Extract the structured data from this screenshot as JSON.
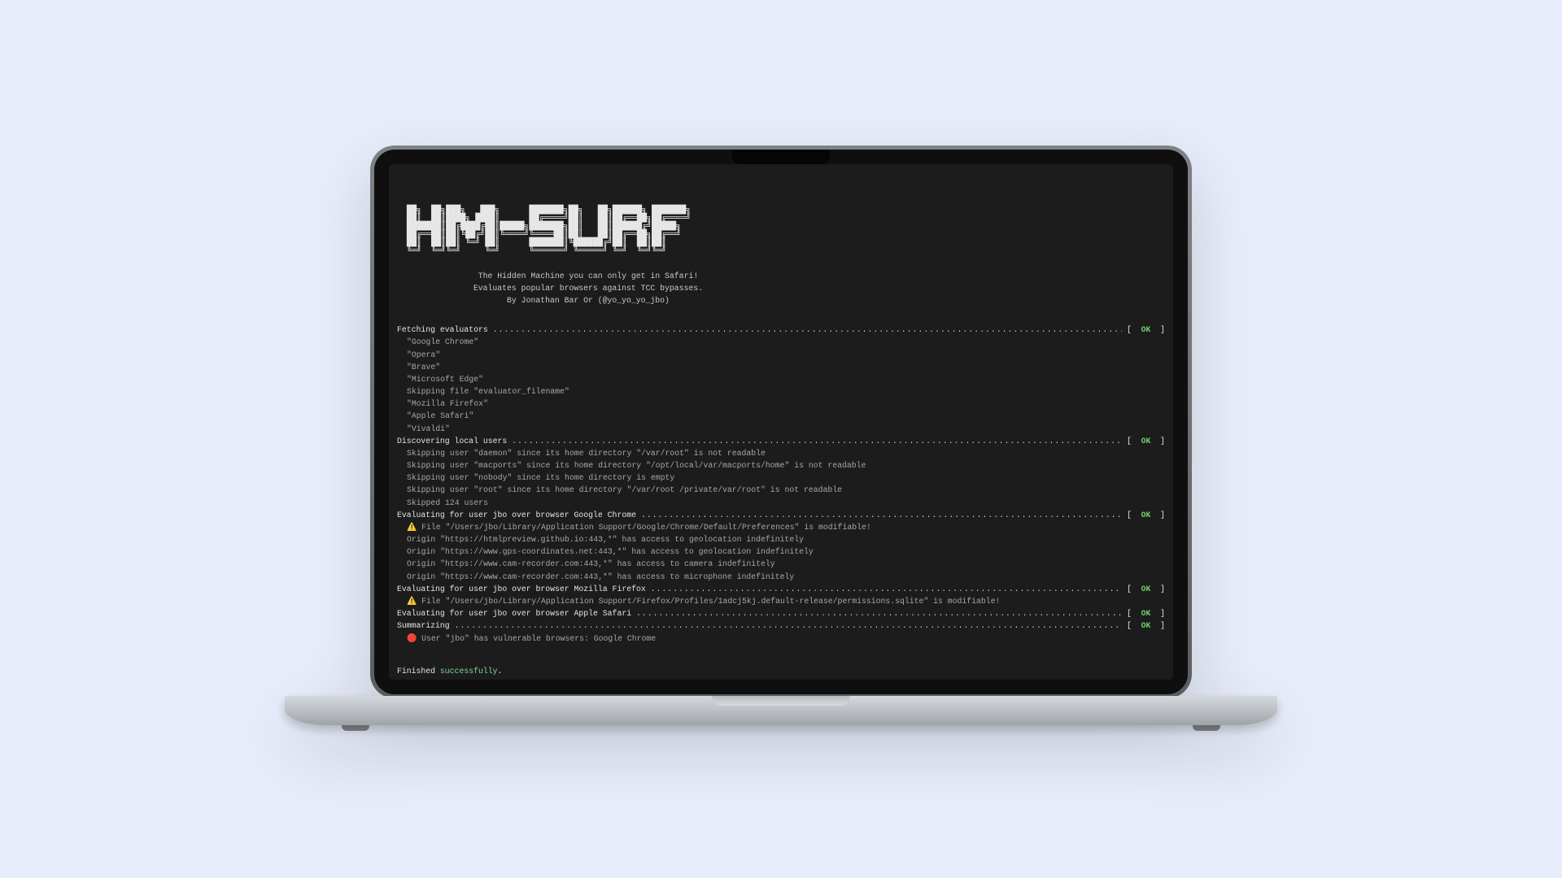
{
  "logo_ascii": "  ██╗  ██╗███╗   ███╗      ███████╗██╗   ██╗██████╗ ███████╗\n  ██║  ██║████╗ ████║      ██╔════╝██║   ██║██╔══██╗██╔════╝\n  ███████║██╔████╔██║█████╗███████╗██║   ██║██████╔╝█████╗  \n  ██╔══██║██║╚██╔╝██║╚════╝╚════██║██║   ██║██╔══██╗██╔══╝  \n  ██║  ██║██║ ╚═╝ ██║      ███████║╚██████╔╝██║  ██║██║     \n  ╚═╝  ╚═╝╚═╝     ╚═╝      ╚══════╝ ╚═════╝ ╚═╝  ╚═╝╚═╝     ",
  "subtitle_line1": "The Hidden Machine you can only get in Safari!",
  "subtitle_line2": "Evaluates popular browsers against TCC bypasses.",
  "subtitle_line3": "By Jonathan Bar Or (@yo_yo_yo_jbo)",
  "status_ok": "OK",
  "bracket_open": "[  ",
  "bracket_close": "  ]",
  "sections": [
    {
      "title": "Fetching evaluators ",
      "children": [
        "\"Google Chrome\"",
        "\"Opera\"",
        "\"Brave\"",
        "\"Microsoft Edge\"",
        "Skipping file \"evaluator_filename\"",
        "\"Mozilla Firefox\"",
        "\"Apple Safari\"",
        "\"Vivaldi\""
      ]
    },
    {
      "title": "Discovering local users ",
      "children": [
        "Skipping user \"daemon\" since its home directory \"/var/root\" is not readable",
        "Skipping user \"macports\" since its home directory \"/opt/local/var/macports/home\" is not readable",
        "Skipping user \"nobody\" since its home directory is empty",
        "Skipping user \"root\" since its home directory \"/var/root /private/var/root\" is not readable",
        "Skipped 124 users"
      ]
    },
    {
      "title": "Evaluating for user jbo over browser Google Chrome ",
      "children_rich": [
        {
          "icon": "⚠️",
          "text": "File \"/Users/jbo/Library/Application Support/Google/Chrome/Default/Preferences\" is modifiable!"
        },
        {
          "icon": "",
          "text": "Origin \"https://htmlpreview.github.io:443,*\" has access to geolocation indefinitely"
        },
        {
          "icon": "",
          "text": "Origin \"https://www.gps-coordinates.net:443,*\" has access to geolocation indefinitely"
        },
        {
          "icon": "",
          "text": "Origin \"https://www.cam-recorder.com:443,*\" has access to camera indefinitely"
        },
        {
          "icon": "",
          "text": "Origin \"https://www.cam-recorder.com:443,*\" has access to microphone indefinitely"
        }
      ]
    },
    {
      "title": "Evaluating for user jbo over browser Mozilla Firefox ",
      "children_rich": [
        {
          "icon": "⚠️",
          "text": "File \"/Users/jbo/Library/Application Support/Firefox/Profiles/1adcj5kj.default-release/permissions.sqlite\" is modifiable!"
        }
      ]
    },
    {
      "title": "Evaluating for user jbo over browser Apple Safari ",
      "children": []
    },
    {
      "title": "Summarizing ",
      "children_rich": [
        {
          "icon": "🛑",
          "text": "User \"jbo\" has vulnerable browsers: Google Chrome"
        }
      ]
    }
  ],
  "finished_prefix": "Finished ",
  "finished_word": "successfully",
  "finished_suffix": "."
}
